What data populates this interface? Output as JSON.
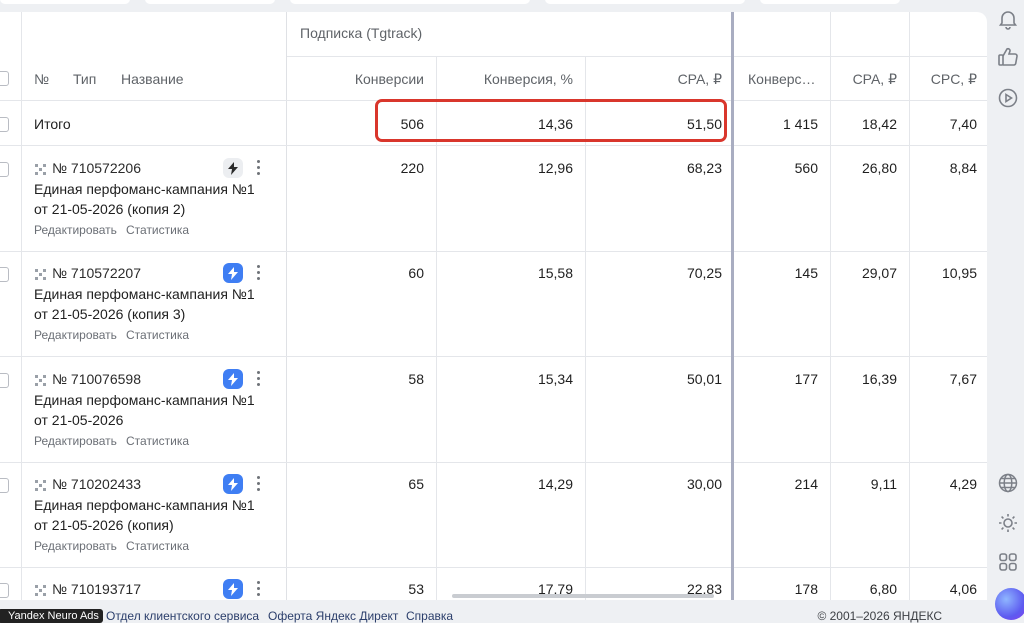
{
  "table": {
    "group_title": "Подписка (Tgtrack)",
    "headers": {
      "num": "№",
      "type": "Тип",
      "name": "Название",
      "conversions": "Конверсии",
      "conversion_rate": "Конверсия, %",
      "cpa": "CPA, ₽",
      "conversions2": "Конверс…",
      "cpa2": "CPA, ₽",
      "cpc": "CPC, ₽"
    },
    "total": {
      "label": "Итого",
      "conversions": "506",
      "conversion_rate": "14,36",
      "cpa": "51,50",
      "conversions2": "1 415",
      "cpa2": "18,42",
      "cpc": "7,40"
    },
    "rows": [
      {
        "id": "№ 710572206",
        "name": "Единая перфоманс-кампания №1 от 21-05-2026 (копия 2)",
        "edit": "Редактировать",
        "stats": "Статистика",
        "bolt_style": "gray",
        "conversions": "220",
        "conversion_rate": "12,96",
        "cpa": "68,23",
        "conversions2": "560",
        "cpa2": "26,80",
        "cpc": "8,84"
      },
      {
        "id": "№ 710572207",
        "name": "Единая перфоманс-кампания №1 от 21-05-2026 (копия 3)",
        "edit": "Редактировать",
        "stats": "Статистика",
        "bolt_style": "blue",
        "conversions": "60",
        "conversion_rate": "15,58",
        "cpa": "70,25",
        "conversions2": "145",
        "cpa2": "29,07",
        "cpc": "10,95"
      },
      {
        "id": "№ 710076598",
        "name": "Единая перфоманс-кампания №1 от 21-05-2026",
        "edit": "Редактировать",
        "stats": "Статистика",
        "bolt_style": "blue",
        "conversions": "58",
        "conversion_rate": "15,34",
        "cpa": "50,01",
        "conversions2": "177",
        "cpa2": "16,39",
        "cpc": "7,67"
      },
      {
        "id": "№ 710202433",
        "name": "Единая перфоманс-кампания №1 от 21-05-2026 (копия)",
        "edit": "Редактировать",
        "stats": "Статистика",
        "bolt_style": "blue",
        "conversions": "65",
        "conversion_rate": "14,29",
        "cpa": "30,00",
        "conversions2": "214",
        "cpa2": "9,11",
        "cpc": "4,29"
      },
      {
        "id": "№ 710193717",
        "name": "",
        "edit": "",
        "stats": "",
        "bolt_style": "blue",
        "conversions": "53",
        "conversion_rate": "17,79",
        "cpa": "22,83",
        "conversions2": "178",
        "cpa2": "6,80",
        "cpc": "4,06"
      }
    ]
  },
  "right_rail": {
    "icons": [
      "bell-icon",
      "thumbs-up-icon",
      "play-circle-icon",
      "globe-icon",
      "sun-icon",
      "apps-grid-icon",
      "alice-assistant-icon"
    ]
  },
  "footer": {
    "badge": "Yandex Neuro Ads",
    "links": [
      "Отдел клиентского сервиса",
      "Оферта Яндекс Директ",
      "Справка"
    ],
    "copyright": "© 2001–2026 ЯНДЕКС"
  },
  "colors": {
    "highlight_border": "#d9362c",
    "bolt_blue": "#3f7ef3",
    "divider": "#a9adc1"
  }
}
